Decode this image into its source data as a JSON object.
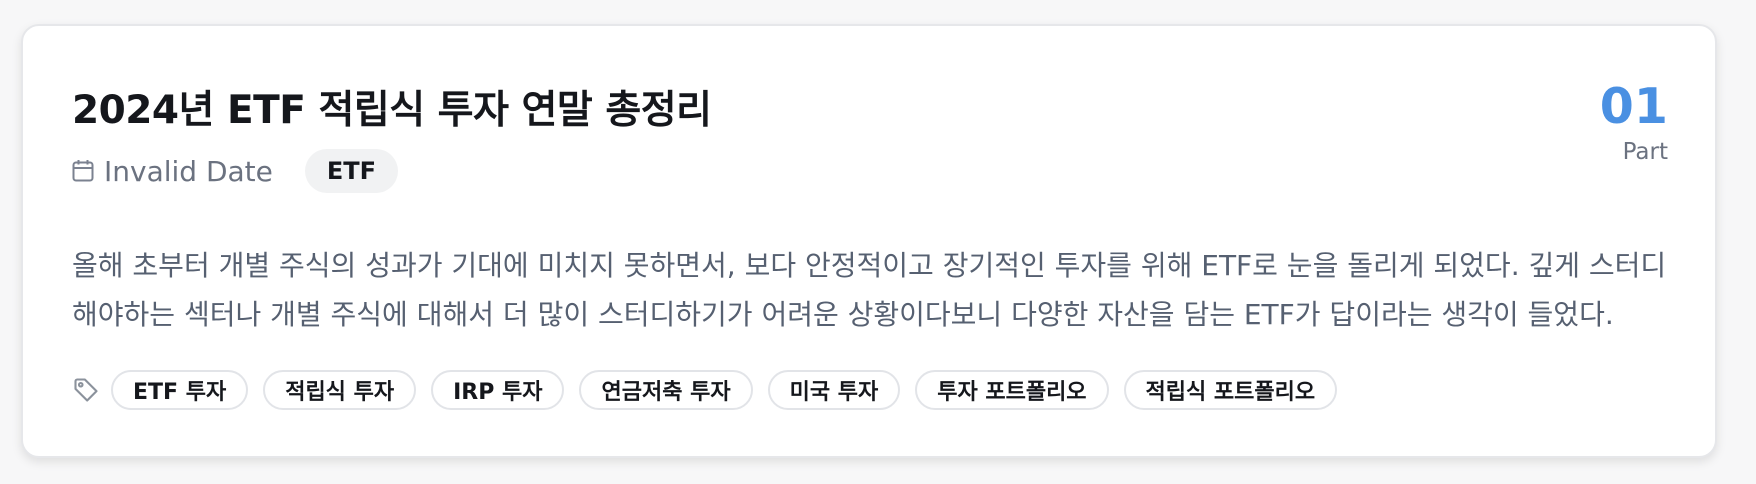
{
  "post": {
    "title": "2024년 ETF 적립식 투자 연말 총정리",
    "date": "Invalid Date",
    "category": "ETF",
    "part_number": "01",
    "part_label": "Part",
    "excerpt": "올해 초부터 개별 주식의 성과가 기대에 미치지 못하면서, 보다 안정적이고 장기적인 투자를 위해 ETF로 눈을 돌리게 되었다. 깊게 스터디해야하는 섹터나 개별 주식에 대해서 더 많이 스터디하기가 어려운 상황이다보니 다양한 자산을 담는 ETF가 답이라는 생각이 들었다.",
    "tags": [
      "ETF 투자",
      "적립식 투자",
      "IRP 투자",
      "연금저축 투자",
      "미국 투자",
      "투자 포트폴리오",
      "적립식 포트폴리오"
    ]
  },
  "icons": {
    "date": "calendar-icon",
    "tags": "tag-icon"
  },
  "colors": {
    "accent": "#4a90e2",
    "title": "#15171c",
    "muted": "#6b7280",
    "badge_bg": "#f1f2f3",
    "border": "#e2e4e8"
  }
}
